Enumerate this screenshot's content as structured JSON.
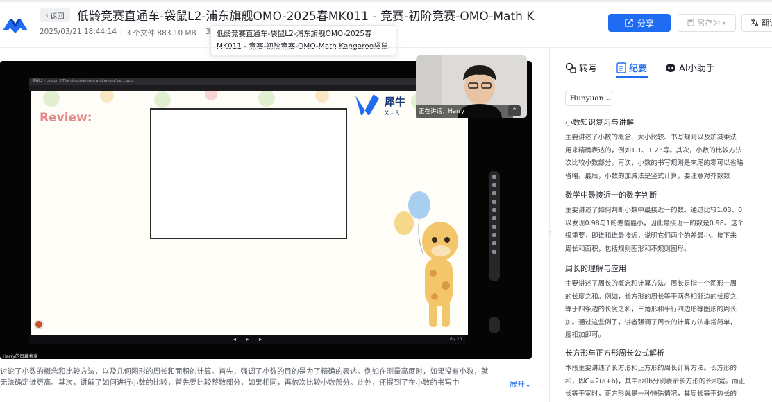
{
  "header": {
    "back_label": "返回",
    "title": "低龄竞赛直通车-袋鼠L2-浦东旗舰OMO-2025春MK011 - 竞赛-初阶竞赛-OMO-Math Kang…",
    "date": "2025/03/21 18:44:14",
    "files": "3 个文件 883.10 MB",
    "meta_tail": "3",
    "tooltip_line1": "低龄竞赛直通车-袋鼠L2-浦东旗舰OMO-2025春",
    "tooltip_line2": "MK011 - 竞赛-初阶竞赛-OMO-Math Kangaroo袋鼠",
    "share_label": "分享",
    "saveas_label": "另存为",
    "translate_label": "翻译",
    "accent": "#1f6cf2"
  },
  "video": {
    "slide_title": "课程L2 · Lesson 3 The circumference and area of ge....pptx",
    "review_label": "Review:",
    "brand_label": "犀牛",
    "speaking_label": "正在讲话：Harry",
    "sharing_label": "Harry的屏幕共享",
    "page_indicator": "6 / 20"
  },
  "summary": {
    "line1": "讨论了小数的概念和比较方法，以及几何图形的周长和面积的计算。首先，强调了小数的目的是为了精确的表达。例如在测量高度时，如果没有小数，就",
    "line2": "无法确定谁更高。其次，讲解了如何进行小数的比较，首先要比较整数部分，如果相同，再依次比较小数部分。此外，还提到了在小数的书写中",
    "expand_label": "展开"
  },
  "right_panel": {
    "tabs": [
      {
        "label": "转写",
        "icon": "transcript-icon"
      },
      {
        "label": "纪要",
        "icon": "document-icon"
      },
      {
        "label": "AI小助手",
        "icon": "ai-assistant-icon"
      }
    ],
    "speaker_select": "Hunyuan",
    "sections": [
      {
        "heading": "小数知识复习与讲解",
        "lines": [
          "主要讲述了小数的概念、大小比较、书写规则以及加减乘法",
          "用来精确表达的，例如1.1、1.23等。其次，小数的比较方法",
          "次比较小数部分。再次，小数的书写规则是末尾的零可以省略",
          "省略。最后，小数的加减法是竖式计算，要注意对齐数数"
        ]
      },
      {
        "heading": "数学中最接近一的数字判断",
        "lines": [
          "主要讲述了如何判断小数中最接近一的数。通过比较1.03、0",
          "以发现0.98与1的差值最小，因此最接近一的数是0.98。这个",
          "很重要，即谁和谁最接近，说明它们两个的差最小。接下来",
          "周长和面积，包括规则图形和不规则图形。"
        ]
      },
      {
        "heading": "周长的理解与应用",
        "lines": [
          "主要讲述了周长的概念和计算方法。周长是指一个图形一周",
          "的长度之和。例如，长方形的周长等于两条相邻边的长度之",
          "等于四条边的长度之和，三角形和平行四边形等图形的周长",
          "加。通过这些例子，讲者强调了周长的计算方法非常简单，",
          "度相加即可。"
        ]
      },
      {
        "heading": "长方形与正方形周长公式解析",
        "lines": [
          "本段主要讲述了长方形和正方形的周长计算方法。长方形的",
          "和，即C=2(a+b)，其中a和b分别表示长方形的长和宽。而正",
          "长等于宽时，正方形就是一种特殊情况，其周长等于边长的"
        ]
      }
    ]
  }
}
